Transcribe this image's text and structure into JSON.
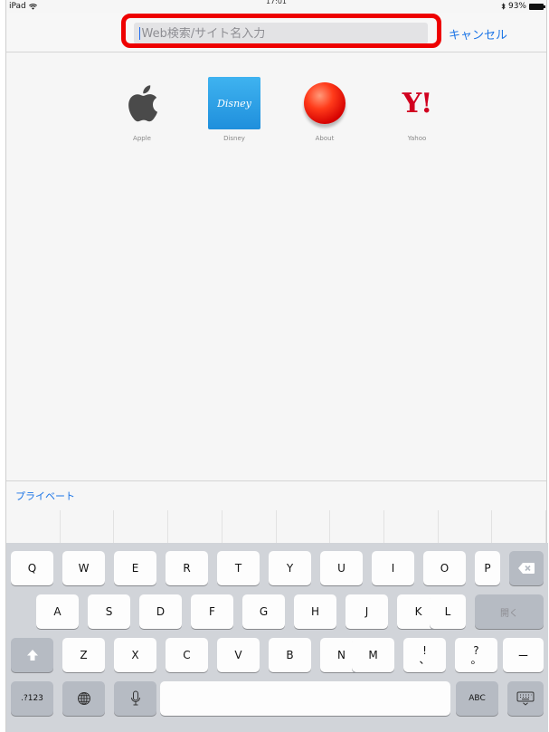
{
  "status_bar": {
    "device": "iPad",
    "time": "17:01",
    "battery": "93%"
  },
  "search": {
    "placeholder": "Web検索/サイト名入力",
    "cancel_label": "キャンセル"
  },
  "favorites": [
    {
      "label": "Apple",
      "icon": "apple-logo-icon"
    },
    {
      "label": "Disney",
      "icon": "disney-logo-icon",
      "tile_text": "Disney"
    },
    {
      "label": "About",
      "icon": "red-ball-icon"
    },
    {
      "label": "Yahoo",
      "icon": "yahoo-logo-icon",
      "tile_text": "Y!"
    }
  ],
  "private_label": "プライベート",
  "keyboard": {
    "row1": [
      "Q",
      "W",
      "E",
      "R",
      "T",
      "Y",
      "U",
      "I",
      "O",
      "P"
    ],
    "row2": [
      "A",
      "S",
      "D",
      "F",
      "G",
      "H",
      "J",
      "K",
      "L"
    ],
    "row3": [
      "Z",
      "X",
      "C",
      "V",
      "B",
      "N",
      "M"
    ],
    "punct1_top": "!",
    "punct1_bottom": "、",
    "punct2_top": "?",
    "punct2_bottom": "。",
    "dash": "ー",
    "return_label": "開く",
    "num_label": ".?123",
    "abc_label": "ABC",
    "colors": {
      "highlight": "#ee0000",
      "accent": "#1b74e6"
    }
  }
}
